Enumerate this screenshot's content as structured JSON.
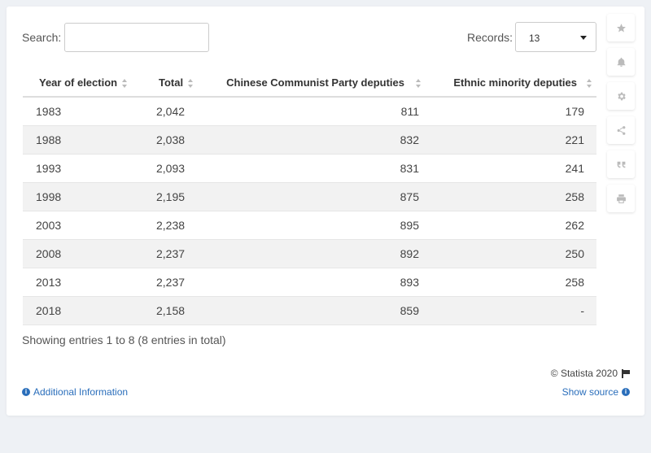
{
  "search": {
    "label": "Search:",
    "value": "",
    "placeholder": ""
  },
  "records": {
    "label": "Records:",
    "value": "13"
  },
  "table": {
    "headers": [
      "Year of election",
      "Total",
      "Chinese Communist Party deputies",
      "Ethnic minority deputies"
    ],
    "rows": [
      [
        "1983",
        "2,042",
        "811",
        "179"
      ],
      [
        "1988",
        "2,038",
        "832",
        "221"
      ],
      [
        "1993",
        "2,093",
        "831",
        "241"
      ],
      [
        "1998",
        "2,195",
        "875",
        "258"
      ],
      [
        "2003",
        "2,238",
        "895",
        "262"
      ],
      [
        "2008",
        "2,237",
        "892",
        "250"
      ],
      [
        "2013",
        "2,237",
        "893",
        "258"
      ],
      [
        "2018",
        "2,158",
        "859",
        "-"
      ]
    ]
  },
  "footer": {
    "showing": "Showing entries 1 to 8 (8 entries in total)",
    "credit": "© Statista 2020",
    "additional_info": "Additional Information",
    "show_source": "Show source"
  },
  "sidebar": {
    "icons": [
      "star-icon",
      "bell-icon",
      "gear-icon",
      "share-icon",
      "quote-icon",
      "print-icon"
    ]
  },
  "colors": {
    "link": "#2a6ebb",
    "alt_row": "#f2f2f2",
    "background": "#eef1f5"
  }
}
